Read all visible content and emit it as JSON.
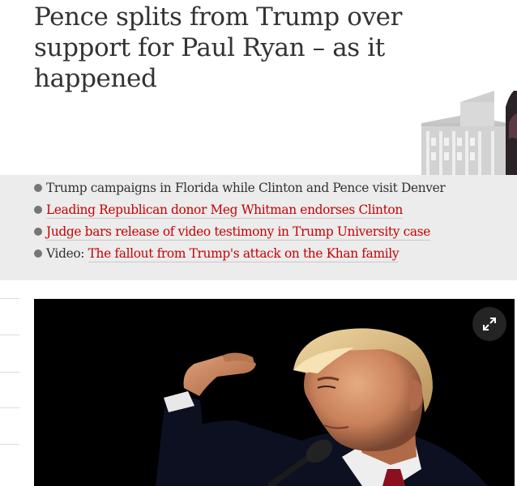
{
  "article": {
    "headline": "Pence splits from Trump over support for Paul Ryan – as it happened"
  },
  "summary": {
    "bullets": [
      {
        "prefix": "",
        "text": "Trump campaigns in Florida while Clinton and Pence visit Denver",
        "is_link": false
      },
      {
        "prefix": "",
        "text": "Leading Republican donor Meg Whitman endorses Clinton",
        "is_link": true
      },
      {
        "prefix": "",
        "text": "Judge bars release of video testimony in Trump University case",
        "is_link": true
      },
      {
        "prefix": "Video: ",
        "text": "The fallout from Trump's attack on the Khan family",
        "is_link": true
      }
    ]
  },
  "media": {
    "expand_icon": "expand-arrows-icon"
  },
  "colors": {
    "link": "#c70000",
    "band": "#ececec",
    "text": "#333333",
    "bullet_dot": "#767676"
  }
}
